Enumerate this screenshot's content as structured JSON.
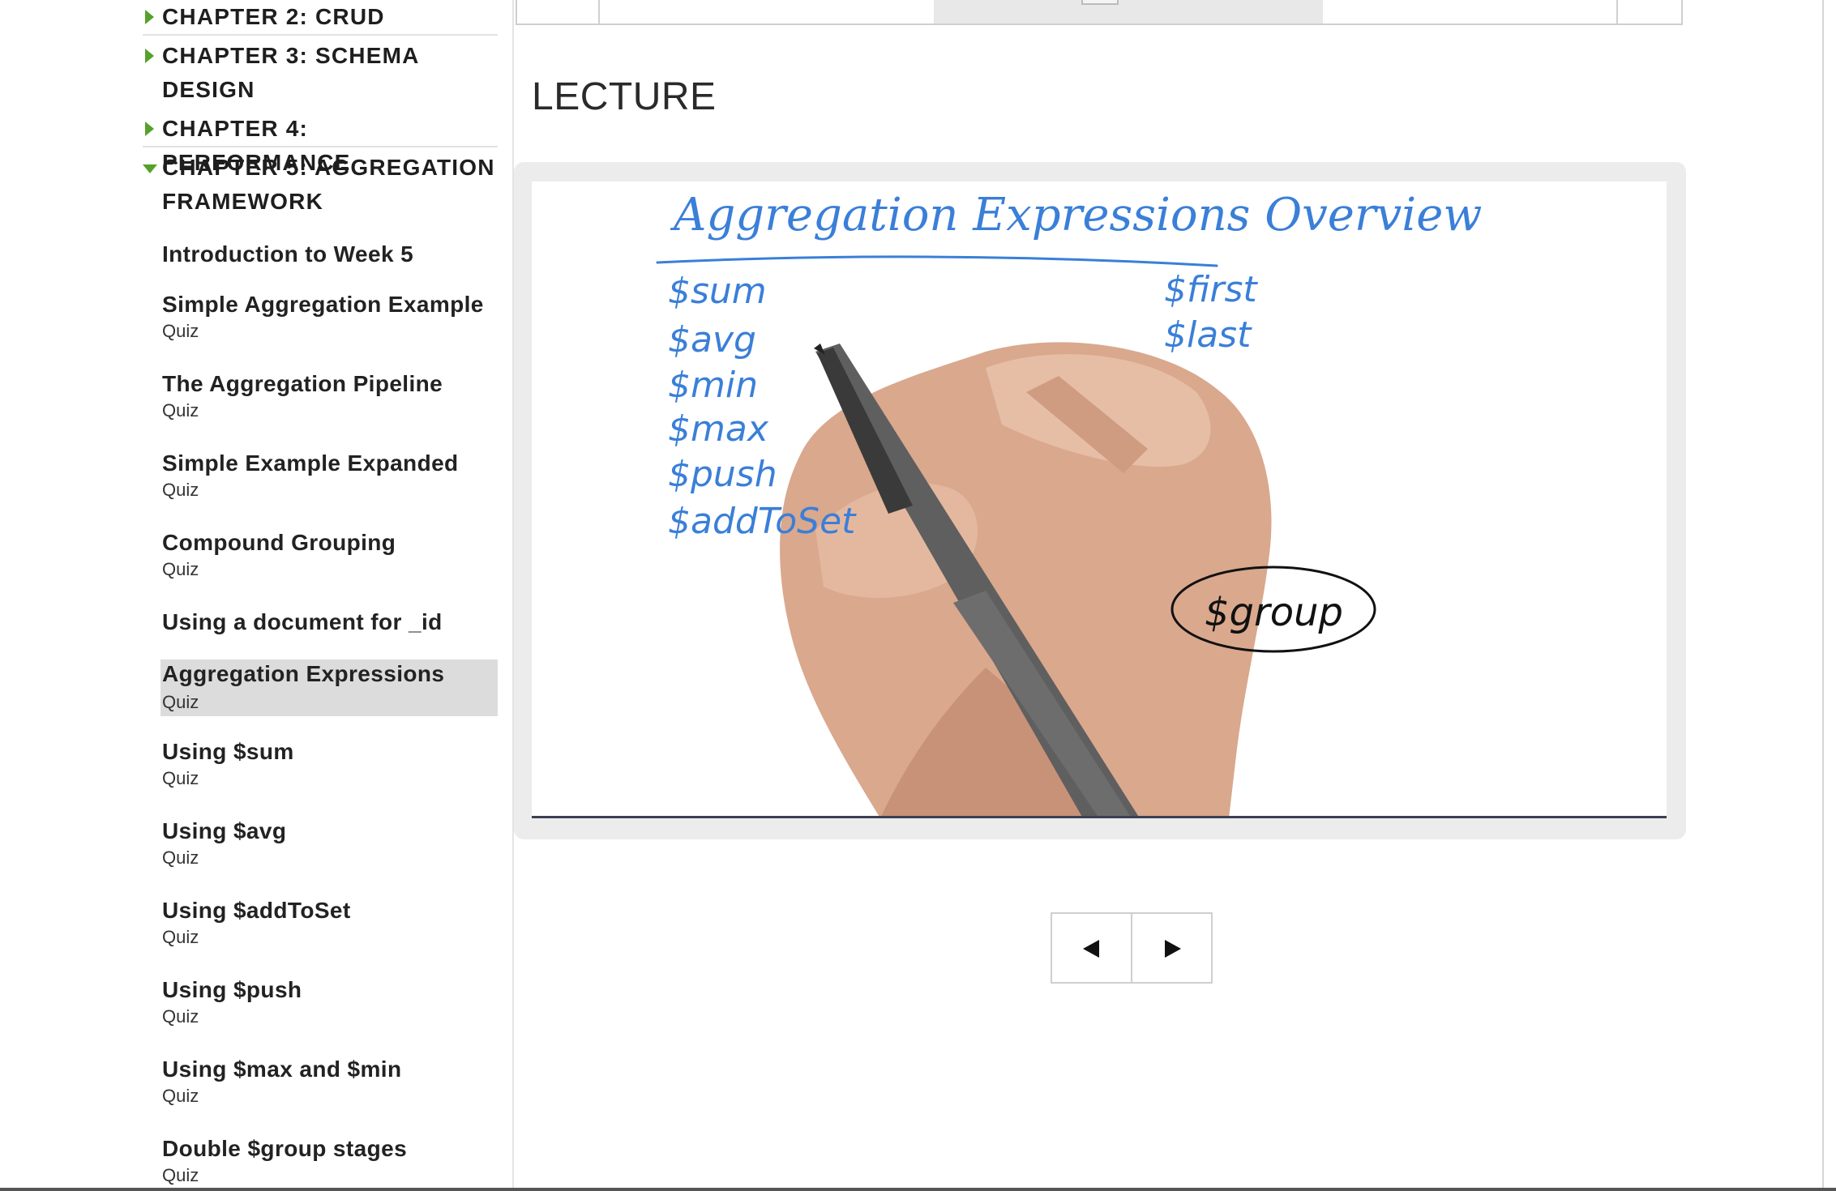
{
  "sidebar": {
    "chapters_top": [
      {
        "label": "CHAPTER 2: CRUD"
      },
      {
        "label_line1": "CHAPTER 3: SCHEMA",
        "label_line2": "DESIGN"
      },
      {
        "label": "CHAPTER 4: PERFORMANCE"
      },
      {
        "label_line1": "CHAPTER 5: AGGREGATION",
        "label_line2": "FRAMEWORK",
        "expanded": true
      }
    ],
    "lessons": [
      {
        "title": "Introduction to Week 5",
        "sub": ""
      },
      {
        "title": "Simple Aggregation Example",
        "sub": "Quiz"
      },
      {
        "title": "The Aggregation Pipeline",
        "sub": "Quiz"
      },
      {
        "title": "Simple Example Expanded",
        "sub": "Quiz"
      },
      {
        "title": "Compound Grouping",
        "sub": "Quiz"
      },
      {
        "title": "Using a document for _id",
        "sub": ""
      },
      {
        "title": "Aggregation Expressions",
        "sub": "Quiz",
        "active": true
      },
      {
        "title": "Using $sum",
        "sub": "Quiz"
      },
      {
        "title": "Using $avg",
        "sub": "Quiz"
      },
      {
        "title": "Using $addToSet",
        "sub": "Quiz"
      },
      {
        "title": "Using $push",
        "sub": "Quiz"
      },
      {
        "title": "Using $max and $min",
        "sub": "Quiz"
      },
      {
        "title": "Double $group stages",
        "sub": "Quiz"
      }
    ]
  },
  "main": {
    "heading": "LECTURE",
    "whiteboard": {
      "title": "Aggregation Expressions Overview",
      "left_items": [
        "$sum",
        "$avg",
        "$min",
        "$max",
        "$push",
        "$addToSet"
      ],
      "right_items": [
        "$first",
        "$last"
      ],
      "circled": "$group",
      "ink_color": "#3a7fd8"
    },
    "pager": {
      "prev_icon": "triangle-left",
      "next_icon": "triangle-right"
    }
  },
  "colors": {
    "accent_green": "#55a12a",
    "active_bg": "#dcdcdc"
  }
}
